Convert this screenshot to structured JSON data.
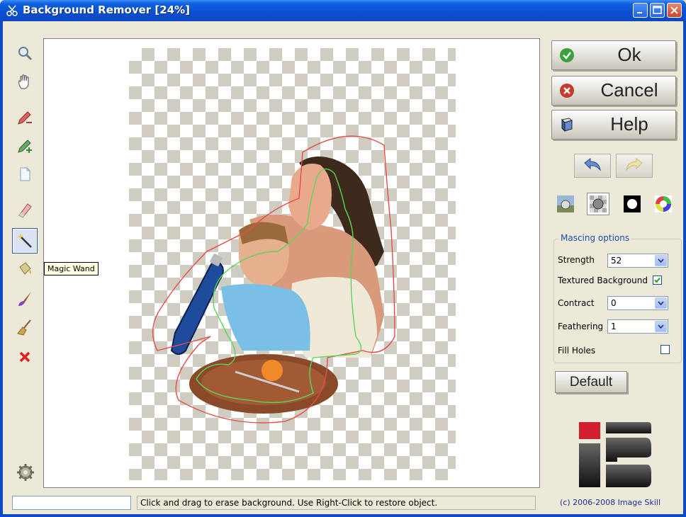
{
  "window": {
    "title": "Background Remover [24%]"
  },
  "toolbar": {
    "tools": [
      {
        "name": "zoom",
        "icon": "magnifier-icon"
      },
      {
        "name": "pan",
        "icon": "hand-icon"
      },
      {
        "name": "pencil-remove",
        "icon": "pencil-minus-icon"
      },
      {
        "name": "pencil-add",
        "icon": "pencil-plus-icon"
      },
      {
        "name": "new",
        "icon": "blank-page-icon"
      },
      {
        "name": "eraser",
        "icon": "eraser-icon"
      },
      {
        "name": "magic-wand",
        "icon": "magic-wand-icon",
        "active": true
      },
      {
        "name": "restore",
        "icon": "bucket-icon"
      },
      {
        "name": "brush",
        "icon": "brush-icon"
      },
      {
        "name": "broom",
        "icon": "broom-icon"
      },
      {
        "name": "clear",
        "icon": "red-x-icon"
      }
    ],
    "tooltip": "Magic Wand",
    "settings_icon": "gear-icon"
  },
  "buttons": {
    "ok": "Ok",
    "cancel": "Cancel",
    "help": "Help",
    "undo_icon": "undo-arrow-icon",
    "redo_icon": "redo-arrow-icon",
    "default": "Default"
  },
  "background_options": [
    {
      "icon": "image-background-icon"
    },
    {
      "icon": "transparent-background-icon",
      "selected": true
    },
    {
      "icon": "black-background-icon"
    },
    {
      "icon": "color-background-icon"
    }
  ],
  "masking": {
    "legend": "Mascing options",
    "strength_label": "Strength",
    "strength_value": "52",
    "textured_label": "Textured Background",
    "textured_checked": true,
    "contract_label": "Contract",
    "contract_value": "0",
    "feathering_label": "Feathering",
    "feathering_value": "1",
    "fill_holes_label": "Fill Holes",
    "fill_holes_checked": false
  },
  "status": {
    "progress_value": 0,
    "message": "Click and drag to erase background. Use Right-Click to restore object.",
    "copyright": "(c) 2006-2008 Image Skill"
  },
  "colors": {
    "titlebar": "#0c49c4",
    "dialog": "#ece9d8",
    "selection_outline": "#e84a4a",
    "mask_outline": "#5ad65a"
  }
}
